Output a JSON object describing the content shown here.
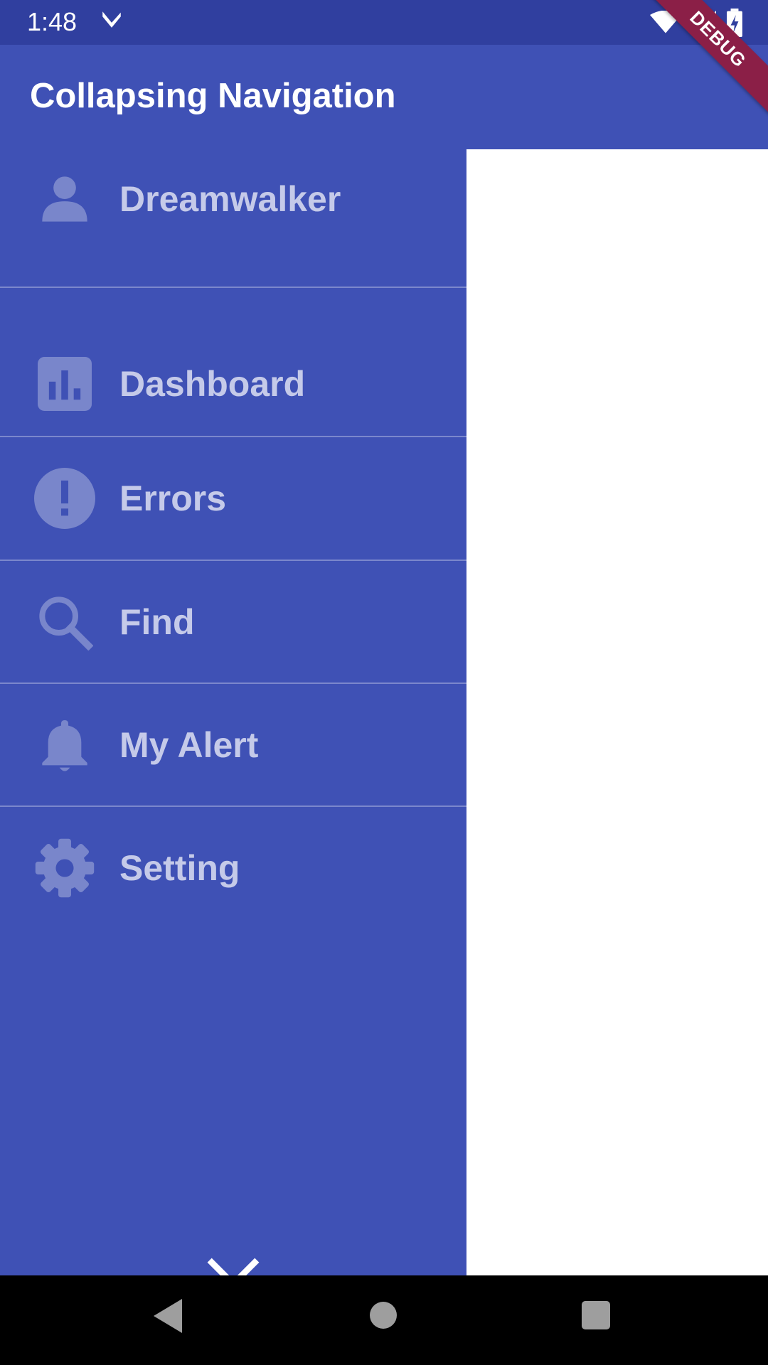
{
  "status_bar": {
    "time": "1:48"
  },
  "app_bar": {
    "title": "Collapsing Navigation",
    "debug_banner": "DEBUG"
  },
  "drawer": {
    "profile": {
      "name": "Dreamwalker",
      "icon": "person-icon"
    },
    "items": [
      {
        "label": "Dashboard",
        "icon": "dashboard-icon"
      },
      {
        "label": "Errors",
        "icon": "error-icon"
      },
      {
        "label": "Find",
        "icon": "search-icon"
      },
      {
        "label": "My Alert",
        "icon": "bell-icon"
      },
      {
        "label": "Setting",
        "icon": "gear-icon"
      }
    ],
    "close_icon": "close-icon"
  },
  "colors": {
    "primary": "#3f51b5",
    "primary_dark": "#303f9f",
    "item_text": "#c5cae9",
    "icon": "#7986cb",
    "debug": "#8b1f47"
  },
  "system_nav": {
    "back_icon": "back-icon",
    "home_icon": "home-icon",
    "recents_icon": "recents-icon"
  }
}
